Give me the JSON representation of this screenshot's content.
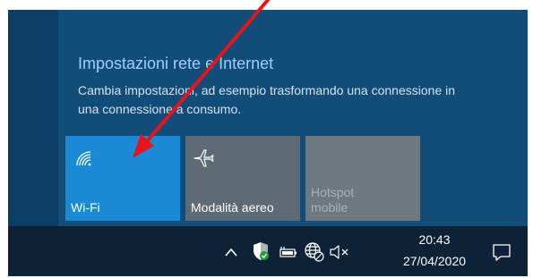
{
  "network_panel": {
    "title": "Impostazioni rete e Internet",
    "description": "Cambia impostazioni, ad esempio trasformando una connessione in una connessione a consumo."
  },
  "quick_actions": [
    {
      "label": "Wi-Fi",
      "icon": "wifi-icon",
      "active": true
    },
    {
      "label": "Modalità aereo",
      "icon": "airplane-icon",
      "active": false
    },
    {
      "label": "Hotspot mobile",
      "icon": "hotspot",
      "active": false,
      "disabled": true
    }
  ],
  "taskbar": {
    "time": "20:43",
    "date": "27/04/2020",
    "tray_icons": [
      "chevron-up-icon",
      "security-shield-icon",
      "battery-icon",
      "network-globe-icon",
      "volume-muted-icon",
      "notification-icon"
    ]
  },
  "colors": {
    "accent": "#1a8ad6",
    "panel": "#124c78",
    "taskbar": "#0d2236",
    "title_text": "#9ed0ff",
    "annotation_arrow": "#e8141b"
  }
}
